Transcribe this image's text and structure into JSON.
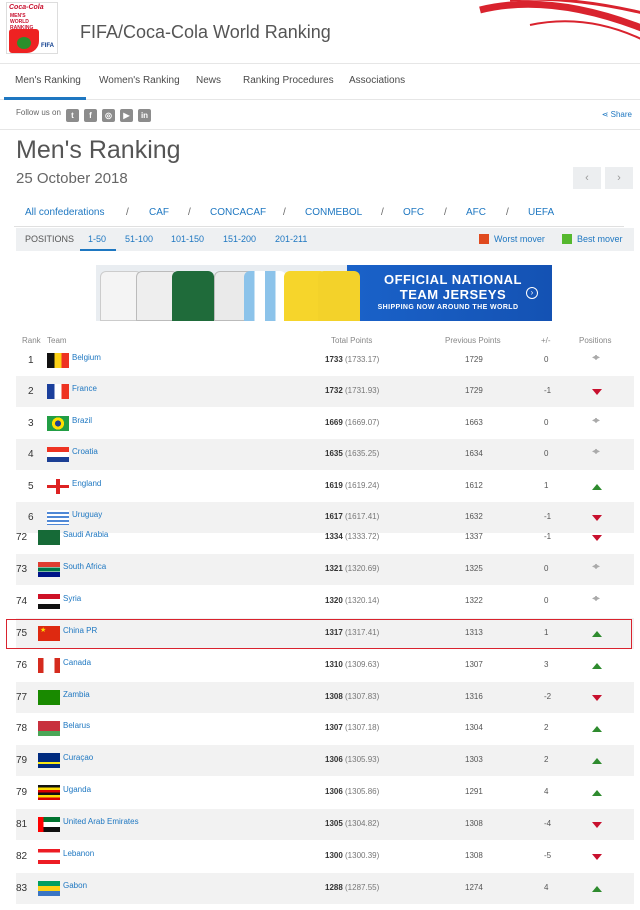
{
  "header": {
    "title": "FIFA/Coca-Cola World Ranking",
    "logo_text": [
      "Coca-Cola",
      "MEN'S",
      "WORLD",
      "RANKING",
      "FIFA"
    ]
  },
  "nav": [
    "Men's Ranking",
    "Women's Ranking",
    "News",
    "Ranking Procedures",
    "Associations"
  ],
  "social": {
    "follow_label": "Follow us on",
    "icons": [
      "twitter-icon",
      "facebook-icon",
      "instagram-icon",
      "youtube-icon",
      "linkedin-icon"
    ],
    "share_label": "Share"
  },
  "page": {
    "title": "Men's Ranking",
    "date": "25 October 2018",
    "prev": "‹",
    "next": "›"
  },
  "confederations": [
    "All confederations",
    "CAF",
    "CONCACAF",
    "CONMEBOL",
    "OFC",
    "AFC",
    "UEFA"
  ],
  "positions": {
    "label": "POSITIONS",
    "ranges": [
      "1-50",
      "51-100",
      "101-150",
      "151-200",
      "201-211"
    ],
    "active": "1-50",
    "worst_mover": "Worst mover",
    "best_mover": "Best mover"
  },
  "banner": {
    "headline": "OFFICIAL NATIONAL TEAM JERSEYS",
    "subline": "SHIPPING NOW AROUND THE WORLD"
  },
  "table": {
    "headers": [
      "Rank",
      "Team",
      "Total Points",
      "Previous Points",
      "+/-",
      "Positions"
    ],
    "rows": [
      {
        "rank": "1",
        "team": "Belgium",
        "points": "1733",
        "exact": "(1733.17)",
        "prev": "1729",
        "diff": "0",
        "move": "same",
        "flag": "belgium"
      },
      {
        "rank": "2",
        "team": "France",
        "points": "1732",
        "exact": "(1731.93)",
        "prev": "1729",
        "diff": "-1",
        "move": "down",
        "flag": "france"
      },
      {
        "rank": "3",
        "team": "Brazil",
        "points": "1669",
        "exact": "(1669.07)",
        "prev": "1663",
        "diff": "0",
        "move": "same",
        "flag": "brazil"
      },
      {
        "rank": "4",
        "team": "Croatia",
        "points": "1635",
        "exact": "(1635.25)",
        "prev": "1634",
        "diff": "0",
        "move": "same",
        "flag": "croatia"
      },
      {
        "rank": "5",
        "team": "England",
        "points": "1619",
        "exact": "(1619.24)",
        "prev": "1612",
        "diff": "1",
        "move": "up",
        "flag": "england"
      },
      {
        "rank": "6",
        "team": "Uruguay",
        "points": "1617",
        "exact": "(1617.41)",
        "prev": "1632",
        "diff": "-1",
        "move": "down",
        "flag": "uruguay"
      },
      {
        "rank": "72",
        "team": "Saudi Arabia",
        "points": "1334",
        "exact": "(1333.72)",
        "prev": "1337",
        "diff": "-1",
        "move": "down",
        "flag": "saudi"
      },
      {
        "rank": "73",
        "team": "South Africa",
        "points": "1321",
        "exact": "(1320.69)",
        "prev": "1325",
        "diff": "0",
        "move": "same",
        "flag": "southafrica"
      },
      {
        "rank": "74",
        "team": "Syria",
        "points": "1320",
        "exact": "(1320.14)",
        "prev": "1322",
        "diff": "0",
        "move": "same",
        "flag": "syria"
      },
      {
        "rank": "75",
        "team": "China PR",
        "points": "1317",
        "exact": "(1317.41)",
        "prev": "1313",
        "diff": "1",
        "move": "up",
        "flag": "china"
      },
      {
        "rank": "76",
        "team": "Canada",
        "points": "1310",
        "exact": "(1309.63)",
        "prev": "1307",
        "diff": "3",
        "move": "up",
        "flag": "canada"
      },
      {
        "rank": "77",
        "team": "Zambia",
        "points": "1308",
        "exact": "(1307.83)",
        "prev": "1316",
        "diff": "-2",
        "move": "down",
        "flag": "zambia"
      },
      {
        "rank": "78",
        "team": "Belarus",
        "points": "1307",
        "exact": "(1307.18)",
        "prev": "1304",
        "diff": "2",
        "move": "up",
        "flag": "belarus"
      },
      {
        "rank": "79",
        "team": "Curaçao",
        "points": "1306",
        "exact": "(1305.93)",
        "prev": "1303",
        "diff": "2",
        "move": "up",
        "flag": "curacao"
      },
      {
        "rank": "79",
        "team": "Uganda",
        "points": "1306",
        "exact": "(1305.86)",
        "prev": "1291",
        "diff": "4",
        "move": "up",
        "flag": "uganda"
      },
      {
        "rank": "81",
        "team": "United Arab Emirates",
        "points": "1305",
        "exact": "(1304.82)",
        "prev": "1308",
        "diff": "-4",
        "move": "down",
        "flag": "uae"
      },
      {
        "rank": "82",
        "team": "Lebanon",
        "points": "1300",
        "exact": "(1300.39)",
        "prev": "1308",
        "diff": "-5",
        "move": "down",
        "flag": "lebanon"
      },
      {
        "rank": "83",
        "team": "Gabon",
        "points": "1288",
        "exact": "(1287.55)",
        "prev": "1274",
        "diff": "4",
        "move": "up",
        "flag": "gabon"
      }
    ]
  },
  "colors": {
    "accent": "#1e77c1",
    "worst": "#e04a1f",
    "best": "#55b82e",
    "highlight": "#d9232e"
  }
}
